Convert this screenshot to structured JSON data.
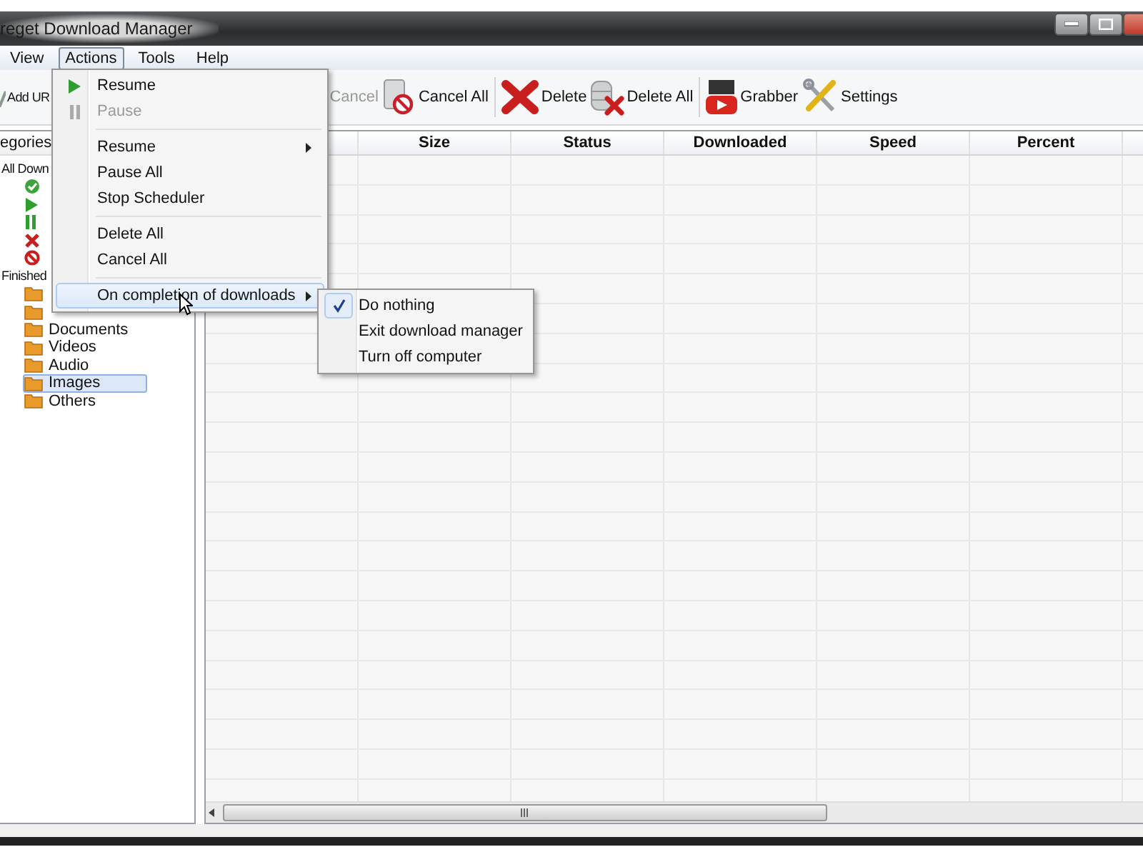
{
  "window": {
    "title": "reget Download Manager"
  },
  "menu_bar": [
    {
      "label": "View",
      "selected": false
    },
    {
      "label": "Actions",
      "selected": true
    },
    {
      "label": "Tools",
      "selected": false
    },
    {
      "label": "Help",
      "selected": false
    }
  ],
  "toolbar": [
    {
      "label": "Add UR",
      "kind": "add",
      "disabled": false
    },
    {
      "label": "Cancel",
      "kind": "hidden-icon",
      "disabled": true
    },
    {
      "label": "Cancel All",
      "kind": "cancel-all",
      "disabled": false
    },
    {
      "label": "Delete",
      "kind": "delete",
      "disabled": false
    },
    {
      "label": "Delete All",
      "kind": "delete-all",
      "disabled": false
    },
    {
      "label": "Grabber",
      "kind": "video",
      "disabled": false
    },
    {
      "label": "Settings",
      "kind": "settings",
      "disabled": false
    }
  ],
  "sidebar": {
    "header": "egories",
    "items": [
      {
        "label": "All Down",
        "children": [
          {
            "kind": "done",
            "selected": false
          },
          {
            "kind": "play",
            "selected": false
          },
          {
            "kind": "pause",
            "selected": false
          },
          {
            "kind": "error",
            "selected": false
          },
          {
            "kind": "stop",
            "selected": false
          }
        ]
      },
      {
        "label": "Finished",
        "children": [
          {
            "kind": "folder",
            "selected": false
          },
          {
            "kind": "folder",
            "selected": false
          },
          {
            "label": "Documents",
            "kind": "folder",
            "selected": false
          },
          {
            "label": "Videos",
            "kind": "folder",
            "selected": false
          },
          {
            "label": "Audio",
            "kind": "folder",
            "selected": false
          },
          {
            "label": "Images",
            "kind": "folder",
            "selected": true
          },
          {
            "label": "Others",
            "kind": "folder",
            "selected": false
          }
        ]
      }
    ]
  },
  "table": {
    "columns": [
      "Size",
      "Status",
      "Downloaded",
      "Speed",
      "Percent"
    ]
  },
  "actions_menu": [
    {
      "label": "Resume",
      "kind": "play",
      "disabled": false,
      "submenu": false,
      "selected": false
    },
    {
      "label": "Pause",
      "kind": "pause",
      "disabled": true,
      "submenu": false,
      "selected": false
    },
    {
      "kind": "separator"
    },
    {
      "label": "Resume",
      "kind": "none",
      "disabled": false,
      "submenu": true,
      "selected": false
    },
    {
      "label": "Pause All",
      "kind": "none",
      "disabled": false,
      "submenu": false,
      "selected": false
    },
    {
      "label": "Stop Scheduler",
      "kind": "none",
      "disabled": false,
      "submenu": false,
      "selected": false
    },
    {
      "kind": "separator"
    },
    {
      "label": "Delete All",
      "kind": "none",
      "disabled": false,
      "submenu": false,
      "selected": false
    },
    {
      "label": "Cancel All",
      "kind": "none",
      "disabled": false,
      "submenu": false,
      "selected": false
    },
    {
      "kind": "separator"
    },
    {
      "label": "On completion of downloads",
      "kind": "none",
      "disabled": false,
      "submenu": true,
      "selected": true
    }
  ],
  "completion_submenu": [
    {
      "label": "Do nothing",
      "checked": true
    },
    {
      "label": "Exit download manager",
      "checked": false
    },
    {
      "label": "Turn off computer",
      "checked": false
    }
  ]
}
